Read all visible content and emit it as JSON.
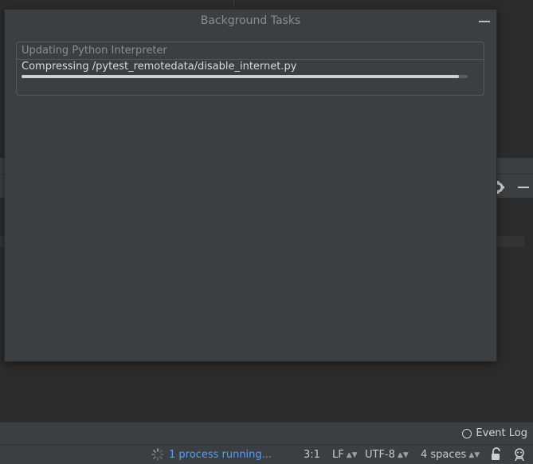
{
  "popup": {
    "title": "Background Tasks",
    "task": {
      "title": "Updating Python Interpreter",
      "detail": "Compressing /pytest_remotedata/disable_internet.py",
      "progress_fraction": 0.98
    }
  },
  "event_log": {
    "label": "Event Log"
  },
  "statusbar": {
    "process": "1 process running...",
    "position": "3:1",
    "line_ending": "LF",
    "encoding": "UTF-8",
    "indent": "4 spaces"
  },
  "icons": {
    "minimize": "minimize-icon",
    "gear": "gear-icon",
    "spinner": "spinner-icon",
    "lock": "lock-icon",
    "inspector": "inspector-icon",
    "event_log": "chat-bubble-icon"
  },
  "colors": {
    "accent": "#589df6",
    "panel": "#3c3f41",
    "background": "#2b2b2b"
  }
}
